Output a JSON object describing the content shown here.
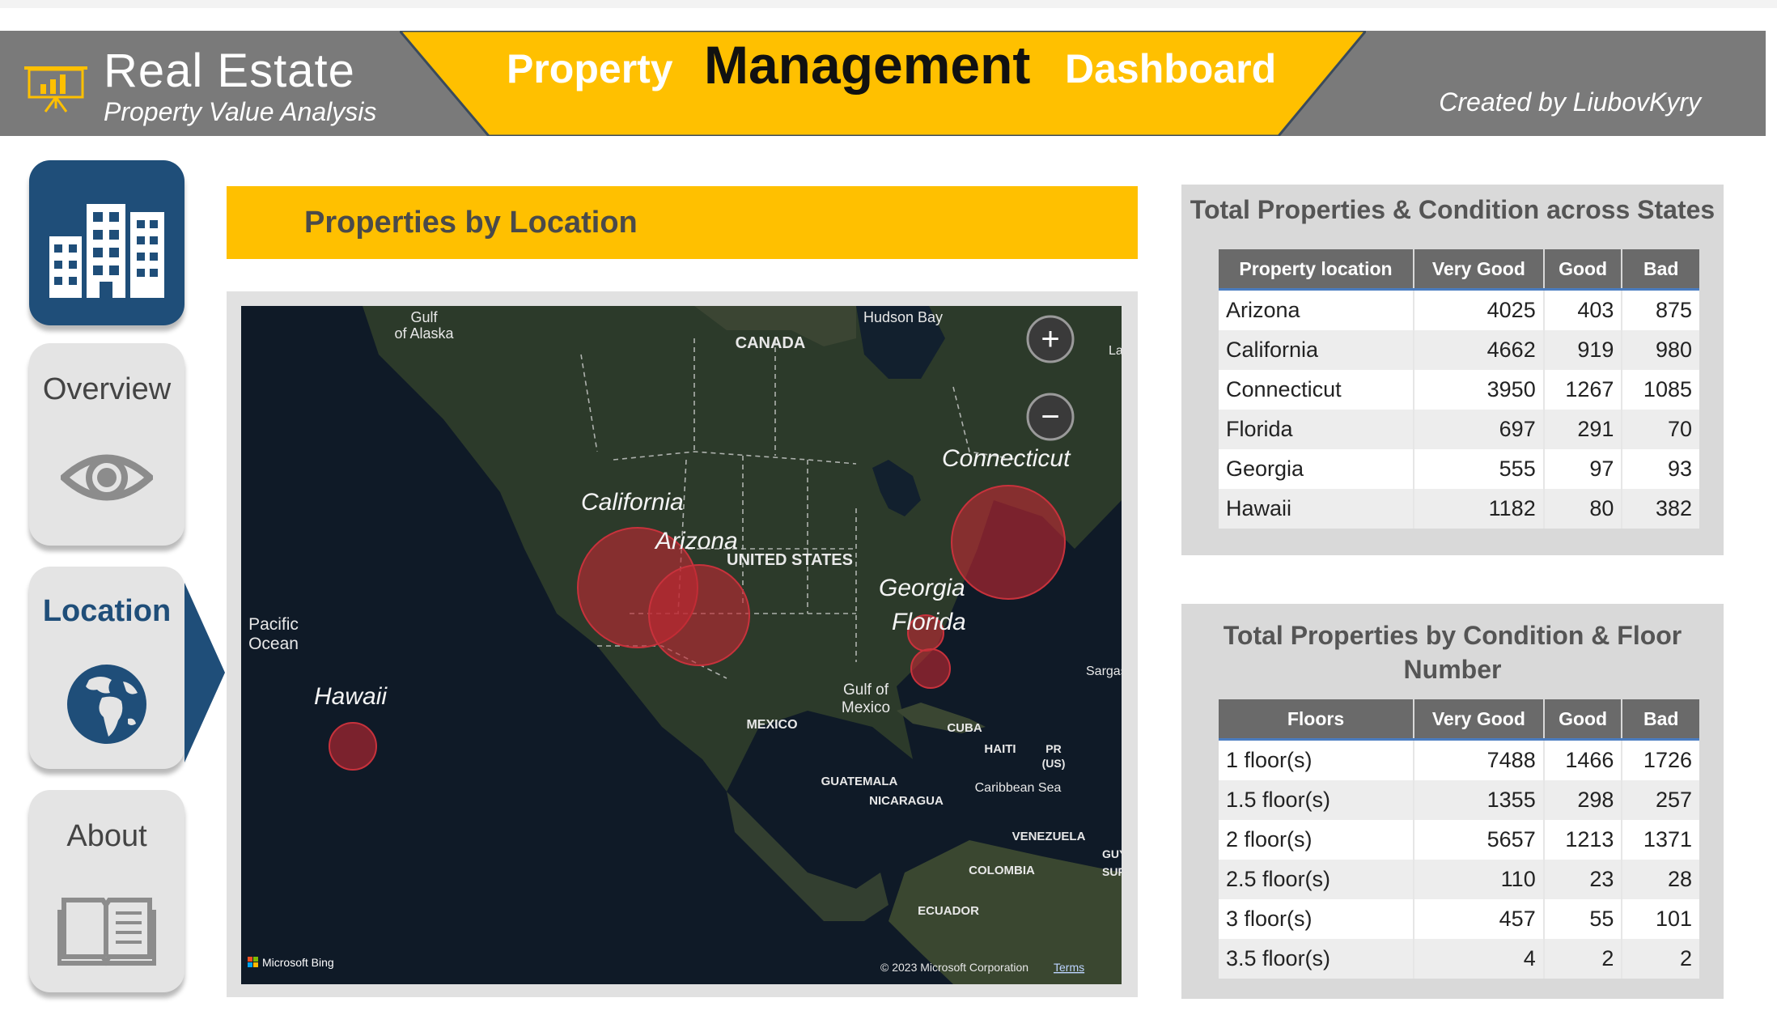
{
  "header": {
    "brand_title": "Real Estate",
    "brand_subtitle": "Property Value Analysis",
    "title_word1": "Property",
    "title_word2": "Management",
    "title_word3": "Dashboard",
    "created_by": "Created by LiubovKyry",
    "colors": {
      "header_gray": "#7a7a7a",
      "accent_yellow": "#ffc000",
      "nav_blue": "#1f4e79"
    }
  },
  "sidebar": {
    "items": [
      {
        "id": "home",
        "label": "",
        "icon": "buildings-icon"
      },
      {
        "id": "overview",
        "label": "Overview",
        "icon": "eye-icon"
      },
      {
        "id": "location",
        "label": "Location",
        "icon": "globe-icon",
        "active": true
      },
      {
        "id": "about",
        "label": "About",
        "icon": "book-icon"
      }
    ]
  },
  "location_section": {
    "title": "Properties by Location"
  },
  "map": {
    "bubbles": [
      {
        "label": "California"
      },
      {
        "label": "Arizona"
      },
      {
        "label": "Connecticut"
      },
      {
        "label": "Georgia"
      },
      {
        "label": "Florida"
      },
      {
        "label": "Hawaii"
      }
    ],
    "geo_labels": {
      "gulf_alaska": [
        "Gulf",
        "of Alaska"
      ],
      "hudson_bay": "Hudson Bay",
      "canada": "CANADA",
      "united_states": "UNITED STATES",
      "pacific_ocean": [
        "Pacific",
        "Ocean"
      ],
      "gulf_mexico": [
        "Gulf of",
        "Mexico"
      ],
      "mexico": "MEXICO",
      "cuba": "CUBA",
      "haiti": "HAITI",
      "pr": [
        "PR",
        "(US)"
      ],
      "guatemala": "GUATEMALA",
      "nicaragua": "NICARAGUA",
      "caribbean": "Caribbean Sea",
      "venezuela": "VENEZUELA",
      "colombia": "COLOMBIA",
      "ecuador": "ECUADOR",
      "sargasso": "Sargasso S",
      "guyana": "GUYA",
      "suriname": "SUR",
      "la": "La"
    },
    "attribution_brand": "Microsoft Bing",
    "copyright": "© 2023 Microsoft Corporation",
    "terms": "Terms",
    "zoom_in_symbol": "+",
    "zoom_out_symbol": "−"
  },
  "states_table": {
    "title": "Total Properties & Condition across States",
    "columns": [
      "Property location",
      "Very Good",
      "Good",
      "Bad"
    ],
    "rows": [
      [
        "Arizona",
        "4025",
        "403",
        "875"
      ],
      [
        "California",
        "4662",
        "919",
        "980"
      ],
      [
        "Connecticut",
        "3950",
        "1267",
        "1085"
      ],
      [
        "Florida",
        "697",
        "291",
        "70"
      ],
      [
        "Georgia",
        "555",
        "97",
        "93"
      ],
      [
        "Hawaii",
        "1182",
        "80",
        "382"
      ]
    ]
  },
  "floors_table": {
    "title_line1": "Total Properties by Condition & Floor",
    "title_line2": "Number",
    "columns": [
      "Floors",
      "Very Good",
      "Good",
      "Bad"
    ],
    "rows": [
      [
        "1 floor(s)",
        "7488",
        "1466",
        "1726"
      ],
      [
        "1.5 floor(s)",
        "1355",
        "298",
        "257"
      ],
      [
        "2 floor(s)",
        "5657",
        "1213",
        "1371"
      ],
      [
        "2.5 floor(s)",
        "110",
        "23",
        "28"
      ],
      [
        "3 floor(s)",
        "457",
        "55",
        "101"
      ],
      [
        "3.5 floor(s)",
        "4",
        "2",
        "2"
      ]
    ]
  }
}
